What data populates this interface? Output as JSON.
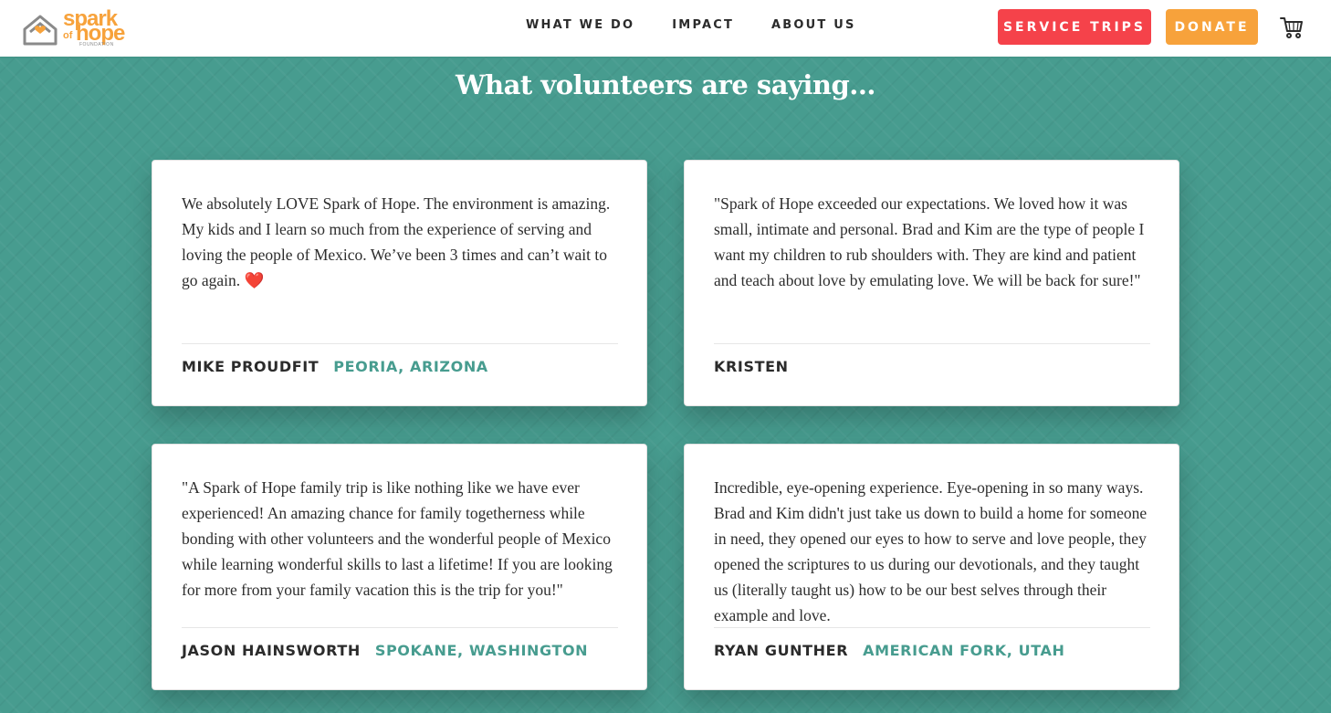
{
  "header": {
    "logo": {
      "spark": "spark",
      "of": "of",
      "hope": "hope",
      "foundation": "FOUNDATION",
      "icon": "house-heart-icon"
    },
    "nav": [
      {
        "label": "WHAT WE DO"
      },
      {
        "label": "IMPACT"
      },
      {
        "label": "ABOUT US"
      }
    ],
    "buttons": {
      "service_trips": "SERVICE TRIPS",
      "donate": "DONATE"
    },
    "cart_icon": "shopping-cart-icon"
  },
  "main": {
    "title": "What volunteers are saying...",
    "testimonials": [
      {
        "text": "We absolutely LOVE Spark of Hope. The environment is amazing. My kids and I learn so much from the experience of serving and loving the people of Mexico. We’ve been 3 times and can’t wait to go again. ❤️",
        "author": "MIKE PROUDFIT",
        "location": "PEORIA, ARIZONA"
      },
      {
        "text": "\"Spark of Hope exceeded our expectations. We loved how it was small, intimate and personal. Brad and Kim are the type of people I want my children to rub shoulders with. They are kind and patient and teach about love by emulating love. We will be back for sure!\"",
        "author": "KRISTEN",
        "location": ""
      },
      {
        "text": "\"A Spark of Hope family trip is like nothing like we have ever experienced! An amazing chance for family togetherness while bonding with other volunteers and the wonderful people of Mexico while learning wonderful skills to last a lifetime! If you are looking for more from your family vacation this is the trip for you!\"",
        "author": "JASON HAINSWORTH",
        "location": "SPOKANE, WASHINGTON"
      },
      {
        "text": "Incredible, eye-opening experience. Eye-opening in so many ways. Brad and Kim didn't just take us down to build a home for someone in need, they opened our eyes to how to serve and love people, they opened the scriptures to us during our devotionals, and they taught us (literally taught us) how to be our best selves through their example and love.",
        "author": "RYAN GUNTHER",
        "location": "AMERICAN FORK, UTAH"
      }
    ]
  },
  "colors": {
    "background_teal": "#479c8f",
    "service_trips_red": "#f5424a",
    "donate_orange": "#f7a23b",
    "location_teal": "#479c8f"
  }
}
